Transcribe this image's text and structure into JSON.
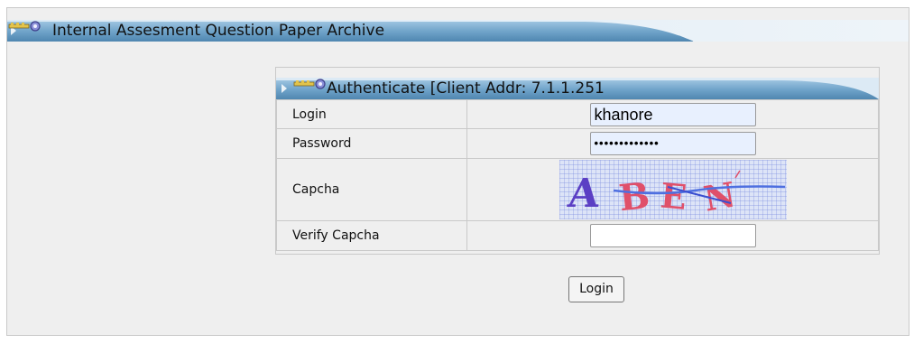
{
  "window": {
    "title": "Internal Assesment Question Paper Archive"
  },
  "auth_panel": {
    "title": "Authenticate  [Client Addr: 7.1.1.251"
  },
  "form": {
    "login_label": "Login",
    "login_value": "khanore",
    "password_label": "Password",
    "password_mask": "•••••••••••••",
    "captcha_label": "Capcha",
    "captcha_text": "ABEN",
    "verify_label": "Verify Capcha",
    "verify_value": "",
    "submit_label": "Login"
  },
  "icons": {
    "header_icon": "key-icon",
    "header_arrow": "play-arrow-icon"
  },
  "colors": {
    "header_gradient_dark": "#4f86b0",
    "header_gradient_light": "#c8dff0",
    "autofill_bg": "#e8f0fe"
  }
}
